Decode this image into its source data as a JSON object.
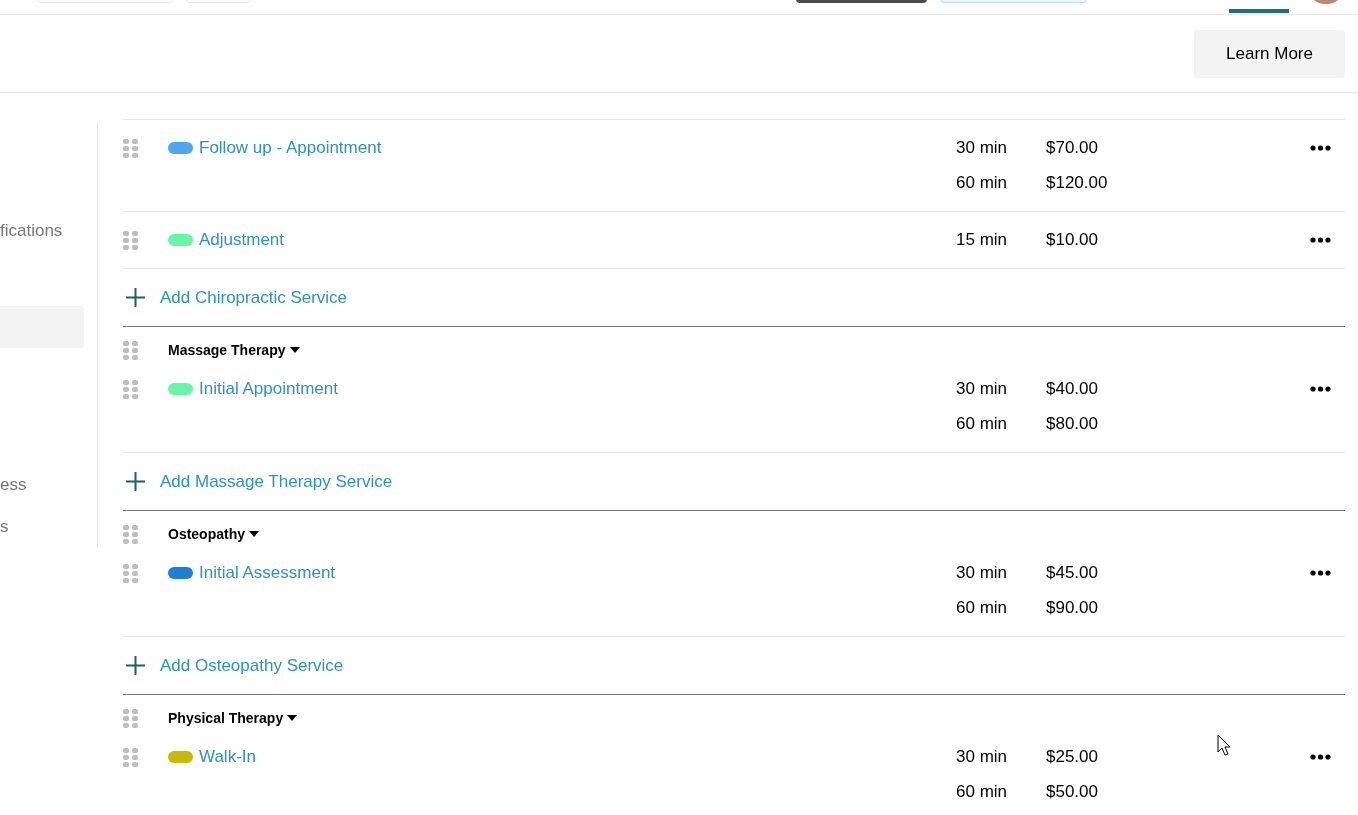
{
  "header": {
    "button": "Learn More"
  },
  "sidebar": {
    "items": [
      {
        "label": "fications",
        "selected": false
      },
      {
        "selected": true
      },
      {
        "label": "ess",
        "selected": false
      },
      {
        "label": "s",
        "selected": false
      }
    ]
  },
  "groups": [
    {
      "services": [
        {
          "name": "Follow up - Appointment",
          "color": "#4ea6ee",
          "options": [
            {
              "duration": "30 min",
              "price": "$70.00"
            },
            {
              "duration": "60 min",
              "price": "$120.00"
            }
          ]
        },
        {
          "name": "Adjustment",
          "color": "#66f7a6",
          "options": [
            {
              "duration": "15 min",
              "price": "$10.00"
            }
          ]
        }
      ],
      "add_label": "Add Chiropractic Service"
    },
    {
      "title": "Massage Therapy",
      "services": [
        {
          "name": "Initial Appointment",
          "color": "#66f7a6",
          "options": [
            {
              "duration": "30 min",
              "price": "$40.00"
            },
            {
              "duration": "60 min",
              "price": "$80.00"
            }
          ]
        }
      ],
      "add_label": "Add Massage Therapy Service"
    },
    {
      "title": "Osteopathy",
      "services": [
        {
          "name": "Initial Assessment",
          "color": "#1b7fd4",
          "options": [
            {
              "duration": "30 min",
              "price": "$45.00"
            },
            {
              "duration": "60 min",
              "price": "$90.00"
            }
          ]
        }
      ],
      "add_label": "Add Osteopathy Service"
    },
    {
      "title": "Physical Therapy",
      "services": [
        {
          "name": "Walk-In",
          "color": "#c9b900",
          "options": [
            {
              "duration": "30 min",
              "price": "$25.00"
            },
            {
              "duration": "60 min",
              "price": "$50.00"
            }
          ]
        }
      ]
    }
  ]
}
